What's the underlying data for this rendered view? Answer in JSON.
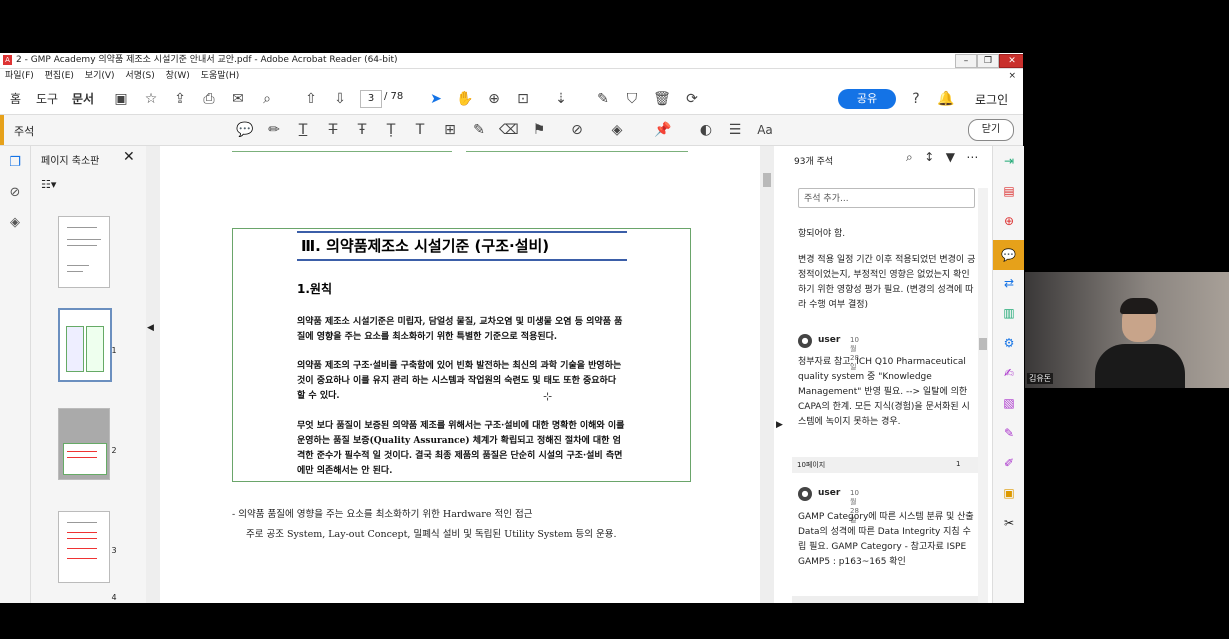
{
  "window": {
    "title": "2 - GMP Academy 의약품 제조소 시설기준 안내서 교안.pdf - Adobe Acrobat Reader (64-bit)",
    "app_icon": "A"
  },
  "menu": [
    "파일(F)",
    "편집(E)",
    "보기(V)",
    "서명(S)",
    "창(W)",
    "도움말(H)"
  ],
  "toolbar": {
    "tabs": [
      "홈",
      "도구",
      "문서"
    ],
    "page_current": "3",
    "page_total": "/ 78",
    "share": "공유",
    "login": "로그인"
  },
  "annotation_bar": {
    "label": "주석",
    "close": "닫기"
  },
  "thumbnails": {
    "title": "페이지 축소판",
    "page_numbers": [
      "1",
      "2",
      "3",
      "4"
    ]
  },
  "document": {
    "heading": "Ⅲ. 의약품제조소 시설기준 (구조·설비)",
    "subheading": "1.원칙",
    "para1": "의약품 제조소 시설기준은 미립자, 담얼성 물질, 교차오염 및 미생물 오염 등 의약품 품질에 영향을 주는 요소를 최소화하기 위한 특별한 기준으로 적용된다.",
    "para2": "의약품 제조의 구조·설비를 구축함에 있어 빈화 발전하는 최신의 과학 기술을 반영하는 것이 중요하나 이를 유지 관리 하는 시스템과 작업원의 숙련도 및 태도 또한 중요하다 할 수 있다.",
    "para3": "무엇 보다 품질이 보증된 의약품 제조를 위해서는 구조·설비에 대한 명확한 이해와 이를 운영하는 품질 보증(Quality Assurance) 체계가 확립되고 정해진 절차에 대한 엄격한 준수가 필수적 일 것이다. 결국 최종 제품의 품질은 단순히 시설의 구조·설비 측면에만 의존해서는 안 된다.",
    "bullet_line1": "-   의약품 품질에 영향을 주는 요소를 최소화하기 위한 Hardware 적인 접근",
    "bullet_line2": "주로 공조 System, Lay-out Concept, 밀폐식 설비 및 독립된 Utility System 등의 운용."
  },
  "comments": {
    "count": "93개 주석",
    "input_placeholder": "주석 추가...",
    "c1_tail": "항되어야 함.",
    "c1_extra": "변경 적용 일정 기간 이후 적용되었던 변경이 긍정적이었는지, 부정적인 영향은 없었는지 확인하기 위한 영향성 평가 필요. (변경의 성격에 따라 수행 여부 결정)",
    "c2_user": "user",
    "c2_date": "10월28일",
    "c2_text": "청부자료 참고. ICH Q10 Pharmaceutical quality system 중 \"Knowledge Management\" 반영 필요. --> 일탈에 의한 CAPA의 한계. 모든 지식(경험)을 문서화된 시스템에 녹이지 못하는 경우.",
    "page_label": "10페이지",
    "page_count": "1",
    "c3_user": "user",
    "c3_date": "10월28일",
    "c3_text": "GAMP Category에 따른 시스템 분류 및 산출 Data의 성격에 따른 Data Integrity 지침 수립 필요. GAMP Category - 참고자료 ISPE GAMP5 : p163~165 확인"
  },
  "webcam": {
    "name": "김유돈"
  }
}
